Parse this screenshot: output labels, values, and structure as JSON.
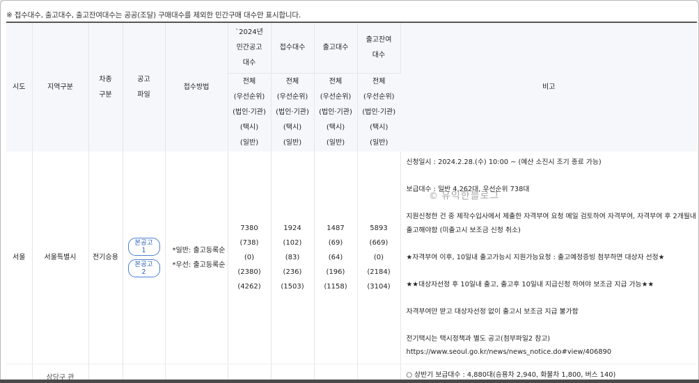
{
  "notice": "※ 접수대수, 출고대수, 출고잔여대수는 공공(조달) 구매대수를 제외한 민간구매 대수만 표시합니다.",
  "headers": {
    "sido": "시도",
    "region": "지역구분",
    "car_type": [
      "차종",
      "구분"
    ],
    "notice_file": [
      "공고",
      "파일"
    ],
    "method": "접수방법",
    "private_notice": [
      "`2024년",
      "민간공고",
      "대수"
    ],
    "received": "접수대수",
    "shipped": "출고대수",
    "remaining": [
      "출고잔여",
      "대수"
    ],
    "remarks": "비고",
    "breakdown": [
      "전체",
      "(우선순위)",
      "(법인·기관)",
      "(택시)",
      "(일반)"
    ]
  },
  "rows": [
    {
      "sido": "서울",
      "region": "서울특별시",
      "car_type": "전기승용",
      "files": [
        [
          "본공고",
          "1"
        ],
        [
          "본공고",
          "2"
        ]
      ],
      "methods": [
        "*일반: 출고등록순",
        "*우선: 출고등록순"
      ],
      "private_notice": [
        "7380",
        "(738)",
        "(0)",
        "(2380)",
        "(4262)"
      ],
      "received": [
        "1924",
        "(102)",
        "(83)",
        "(236)",
        "(1503)"
      ],
      "shipped": [
        "1487",
        "(69)",
        "(64)",
        "(196)",
        "(1158)"
      ],
      "remaining": [
        "5893",
        "(669)",
        "(0)",
        "(2184)",
        "(3104)"
      ],
      "remarks": [
        "신청일시 : 2024.2.28.(수) 10:00 ~ (예산 소진시 조기 종료 가능)",
        "",
        "보급대수 : 일반 4,262대, 우선순위 738대",
        "",
        "지원신청한 건 중 제작수입사에서 제출한 자격부여 요청 메일 검토하여 자격부여, 자격부여 후 2개월내",
        "출고해야함 (미출고시 보조금 신청 취소)",
        "",
        "★자격부여 이후, 10일내 출고가능시 지원가능요청 : 출고예정증빙 첨부하면 대상자 선정★",
        "",
        "★★대상자선정 후 10일내 출고, 출고후 10일내 지급신청 하여야 보조금 지급 가능★★",
        "",
        "자격부여만 받고 대상자선정 없이 출고시 보조금 지급 불가함",
        "",
        "전기택시는 택시정책과 별도 공고(첨부파일2 참고)",
        "https://www.seoul.go.kr/news/news_notice.do#view/406890"
      ]
    },
    {
      "region": "상당구 관",
      "remarks": [
        "○ 상반기 보급대수 : 4,880대(승용차 2,940, 화물차 1,800, 버스 140)"
      ]
    }
  ],
  "watermark": {
    "symbol": "©",
    "text": "유익한블로그"
  }
}
